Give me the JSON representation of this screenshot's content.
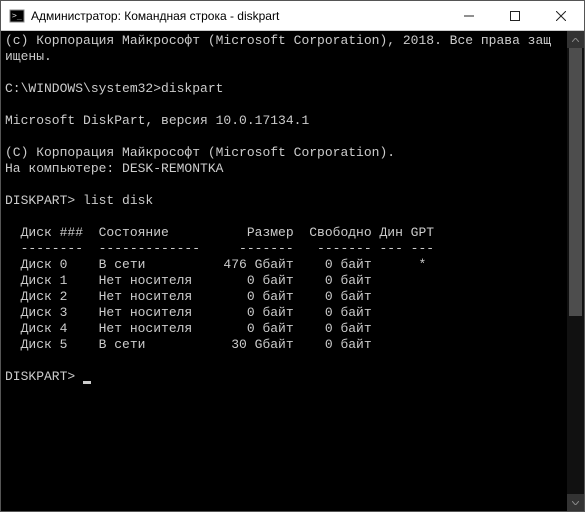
{
  "titlebar": {
    "title": "Администратор: Командная строка - diskpart",
    "icon_name": "cmd-icon"
  },
  "terminal": {
    "copyright1": "(с) Корпорация Майкрософт (Microsoft Corporation), 2018. Все права защ",
    "copyright2": "ищены.",
    "prompt1_path": "C:\\WINDOWS\\system32>",
    "prompt1_cmd": "diskpart",
    "version_line": "Microsoft DiskPart, версия 10.0.17134.1",
    "copyright3": "(C) Корпорация Майкрософт (Microsoft Corporation).",
    "computer_line": "На компьютере: DESK-REMONTKA",
    "prompt2_prefix": "DISKPART> ",
    "prompt2_cmd": "list disk",
    "headers": {
      "disk": "Диск ###",
      "status": "Состояние",
      "size": "Размер",
      "free": "Свободно",
      "dyn": "Дин",
      "gpt": "GPT"
    },
    "separators": {
      "disk": "--------",
      "status": "-------------",
      "size": "-------",
      "free": "-------",
      "dyn": "---",
      "gpt": "---"
    },
    "disks": [
      {
        "name": "Диск 0",
        "status": "В сети",
        "size": "476 Gбайт",
        "free": "0 байт",
        "dyn": "",
        "gpt": "*"
      },
      {
        "name": "Диск 1",
        "status": "Нет носителя",
        "size": "0 байт",
        "free": "0 байт",
        "dyn": "",
        "gpt": ""
      },
      {
        "name": "Диск 2",
        "status": "Нет носителя",
        "size": "0 байт",
        "free": "0 байт",
        "dyn": "",
        "gpt": ""
      },
      {
        "name": "Диск 3",
        "status": "Нет носителя",
        "size": "0 байт",
        "free": "0 байт",
        "dyn": "",
        "gpt": ""
      },
      {
        "name": "Диск 4",
        "status": "Нет носителя",
        "size": "0 байт",
        "free": "0 байт",
        "dyn": "",
        "gpt": ""
      },
      {
        "name": "Диск 5",
        "status": "В сети",
        "size": "30 Gбайт",
        "free": "0 байт",
        "dyn": "",
        "gpt": ""
      }
    ],
    "prompt3_prefix": "DISKPART> "
  },
  "chart_data": {
    "type": "table",
    "title": "DiskPart — list disk",
    "columns": [
      "Диск ###",
      "Состояние",
      "Размер",
      "Свободно",
      "Дин",
      "GPT"
    ],
    "rows": [
      [
        "Диск 0",
        "В сети",
        "476 Gбайт",
        "0 байт",
        "",
        "*"
      ],
      [
        "Диск 1",
        "Нет носителя",
        "0 байт",
        "0 байт",
        "",
        ""
      ],
      [
        "Диск 2",
        "Нет носителя",
        "0 байт",
        "0 байт",
        "",
        ""
      ],
      [
        "Диск 3",
        "Нет носителя",
        "0 байт",
        "0 байт",
        "",
        ""
      ],
      [
        "Диск 4",
        "Нет носителя",
        "0 байт",
        "0 байт",
        "",
        ""
      ],
      [
        "Диск 5",
        "В сети",
        "30 Gбайт",
        "0 байт",
        "",
        ""
      ]
    ]
  }
}
